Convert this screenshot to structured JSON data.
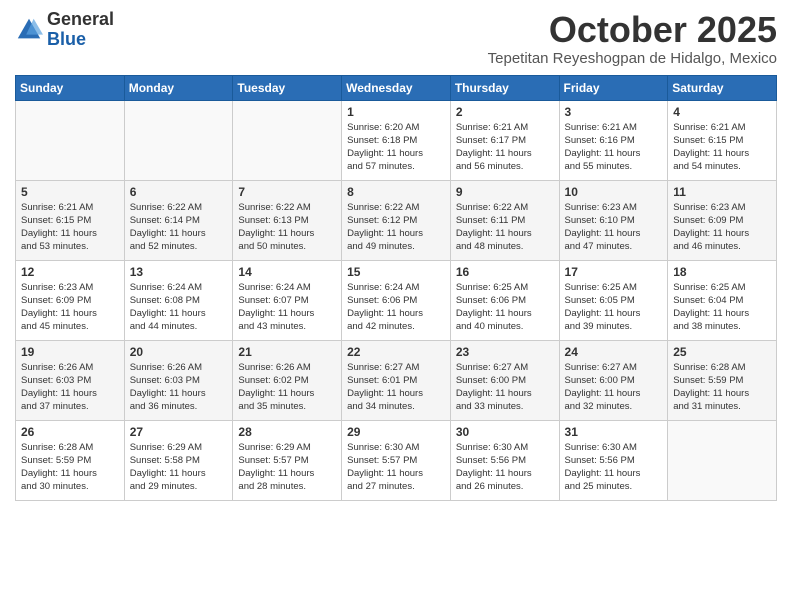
{
  "header": {
    "logo_line1": "General",
    "logo_line2": "Blue",
    "month": "October 2025",
    "location": "Tepetitan Reyeshogpan de Hidalgo, Mexico"
  },
  "weekdays": [
    "Sunday",
    "Monday",
    "Tuesday",
    "Wednesday",
    "Thursday",
    "Friday",
    "Saturday"
  ],
  "weeks": [
    [
      {
        "day": "",
        "info": ""
      },
      {
        "day": "",
        "info": ""
      },
      {
        "day": "",
        "info": ""
      },
      {
        "day": "1",
        "info": "Sunrise: 6:20 AM\nSunset: 6:18 PM\nDaylight: 11 hours\nand 57 minutes."
      },
      {
        "day": "2",
        "info": "Sunrise: 6:21 AM\nSunset: 6:17 PM\nDaylight: 11 hours\nand 56 minutes."
      },
      {
        "day": "3",
        "info": "Sunrise: 6:21 AM\nSunset: 6:16 PM\nDaylight: 11 hours\nand 55 minutes."
      },
      {
        "day": "4",
        "info": "Sunrise: 6:21 AM\nSunset: 6:15 PM\nDaylight: 11 hours\nand 54 minutes."
      }
    ],
    [
      {
        "day": "5",
        "info": "Sunrise: 6:21 AM\nSunset: 6:15 PM\nDaylight: 11 hours\nand 53 minutes."
      },
      {
        "day": "6",
        "info": "Sunrise: 6:22 AM\nSunset: 6:14 PM\nDaylight: 11 hours\nand 52 minutes."
      },
      {
        "day": "7",
        "info": "Sunrise: 6:22 AM\nSunset: 6:13 PM\nDaylight: 11 hours\nand 50 minutes."
      },
      {
        "day": "8",
        "info": "Sunrise: 6:22 AM\nSunset: 6:12 PM\nDaylight: 11 hours\nand 49 minutes."
      },
      {
        "day": "9",
        "info": "Sunrise: 6:22 AM\nSunset: 6:11 PM\nDaylight: 11 hours\nand 48 minutes."
      },
      {
        "day": "10",
        "info": "Sunrise: 6:23 AM\nSunset: 6:10 PM\nDaylight: 11 hours\nand 47 minutes."
      },
      {
        "day": "11",
        "info": "Sunrise: 6:23 AM\nSunset: 6:09 PM\nDaylight: 11 hours\nand 46 minutes."
      }
    ],
    [
      {
        "day": "12",
        "info": "Sunrise: 6:23 AM\nSunset: 6:09 PM\nDaylight: 11 hours\nand 45 minutes."
      },
      {
        "day": "13",
        "info": "Sunrise: 6:24 AM\nSunset: 6:08 PM\nDaylight: 11 hours\nand 44 minutes."
      },
      {
        "day": "14",
        "info": "Sunrise: 6:24 AM\nSunset: 6:07 PM\nDaylight: 11 hours\nand 43 minutes."
      },
      {
        "day": "15",
        "info": "Sunrise: 6:24 AM\nSunset: 6:06 PM\nDaylight: 11 hours\nand 42 minutes."
      },
      {
        "day": "16",
        "info": "Sunrise: 6:25 AM\nSunset: 6:06 PM\nDaylight: 11 hours\nand 40 minutes."
      },
      {
        "day": "17",
        "info": "Sunrise: 6:25 AM\nSunset: 6:05 PM\nDaylight: 11 hours\nand 39 minutes."
      },
      {
        "day": "18",
        "info": "Sunrise: 6:25 AM\nSunset: 6:04 PM\nDaylight: 11 hours\nand 38 minutes."
      }
    ],
    [
      {
        "day": "19",
        "info": "Sunrise: 6:26 AM\nSunset: 6:03 PM\nDaylight: 11 hours\nand 37 minutes."
      },
      {
        "day": "20",
        "info": "Sunrise: 6:26 AM\nSunset: 6:03 PM\nDaylight: 11 hours\nand 36 minutes."
      },
      {
        "day": "21",
        "info": "Sunrise: 6:26 AM\nSunset: 6:02 PM\nDaylight: 11 hours\nand 35 minutes."
      },
      {
        "day": "22",
        "info": "Sunrise: 6:27 AM\nSunset: 6:01 PM\nDaylight: 11 hours\nand 34 minutes."
      },
      {
        "day": "23",
        "info": "Sunrise: 6:27 AM\nSunset: 6:00 PM\nDaylight: 11 hours\nand 33 minutes."
      },
      {
        "day": "24",
        "info": "Sunrise: 6:27 AM\nSunset: 6:00 PM\nDaylight: 11 hours\nand 32 minutes."
      },
      {
        "day": "25",
        "info": "Sunrise: 6:28 AM\nSunset: 5:59 PM\nDaylight: 11 hours\nand 31 minutes."
      }
    ],
    [
      {
        "day": "26",
        "info": "Sunrise: 6:28 AM\nSunset: 5:59 PM\nDaylight: 11 hours\nand 30 minutes."
      },
      {
        "day": "27",
        "info": "Sunrise: 6:29 AM\nSunset: 5:58 PM\nDaylight: 11 hours\nand 29 minutes."
      },
      {
        "day": "28",
        "info": "Sunrise: 6:29 AM\nSunset: 5:57 PM\nDaylight: 11 hours\nand 28 minutes."
      },
      {
        "day": "29",
        "info": "Sunrise: 6:30 AM\nSunset: 5:57 PM\nDaylight: 11 hours\nand 27 minutes."
      },
      {
        "day": "30",
        "info": "Sunrise: 6:30 AM\nSunset: 5:56 PM\nDaylight: 11 hours\nand 26 minutes."
      },
      {
        "day": "31",
        "info": "Sunrise: 6:30 AM\nSunset: 5:56 PM\nDaylight: 11 hours\nand 25 minutes."
      },
      {
        "day": "",
        "info": ""
      }
    ]
  ]
}
